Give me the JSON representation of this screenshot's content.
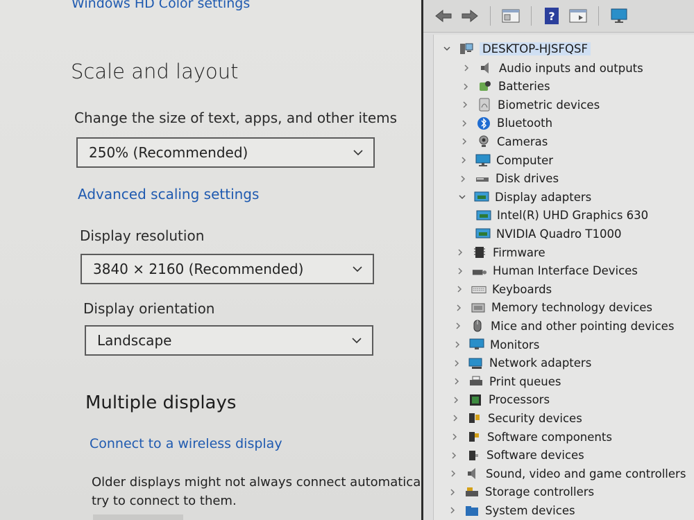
{
  "settings": {
    "top_link": "Windows HD Color settings",
    "scale_section_title": "Scale and layout",
    "scale_label": "Change the size of text, apps, and other items",
    "scale_value": "250% (Recommended)",
    "advanced_link": "Advanced scaling settings",
    "resolution_label": "Display resolution",
    "resolution_value": "3840 × 2160 (Recommended)",
    "orientation_label": "Display orientation",
    "orientation_value": "Landscape",
    "multiple_title": "Multiple displays",
    "wireless_link": "Connect to a wireless display",
    "desc_line1": "Older displays might not always connect automatically",
    "desc_line2": "try to connect to them."
  },
  "devmgr": {
    "toolbar_icons": [
      "back-arrow-icon",
      "forward-arrow-icon",
      "properties-icon",
      "help-icon",
      "update-driver-icon",
      "monitor-icon"
    ],
    "root": "DESKTOP-HJSFQSF",
    "items": [
      {
        "label": "Audio inputs and outputs",
        "icon": "speaker-icon"
      },
      {
        "label": "Batteries",
        "icon": "battery-icon"
      },
      {
        "label": "Biometric devices",
        "icon": "fingerprint-icon"
      },
      {
        "label": "Bluetooth",
        "icon": "bluetooth-icon"
      },
      {
        "label": "Cameras",
        "icon": "camera-icon"
      },
      {
        "label": "Computer",
        "icon": "computer-icon"
      },
      {
        "label": "Disk drives",
        "icon": "disk-icon"
      },
      {
        "label": "Display adapters",
        "icon": "display-adapter-icon"
      },
      {
        "label": "Intel(R) UHD Graphics 630",
        "icon": "display-adapter-icon"
      },
      {
        "label": "NVIDIA Quadro T1000",
        "icon": "display-adapter-icon"
      },
      {
        "label": "Firmware",
        "icon": "chip-icon"
      },
      {
        "label": "Human Interface Devices",
        "icon": "hid-icon"
      },
      {
        "label": "Keyboards",
        "icon": "keyboard-icon"
      },
      {
        "label": "Memory technology devices",
        "icon": "memory-icon"
      },
      {
        "label": "Mice and other pointing devices",
        "icon": "mouse-icon"
      },
      {
        "label": "Monitors",
        "icon": "monitor-icon"
      },
      {
        "label": "Network adapters",
        "icon": "network-icon"
      },
      {
        "label": "Print queues",
        "icon": "printer-icon"
      },
      {
        "label": "Processors",
        "icon": "processor-icon"
      },
      {
        "label": "Security devices",
        "icon": "security-icon"
      },
      {
        "label": "Software components",
        "icon": "software-component-icon"
      },
      {
        "label": "Software devices",
        "icon": "software-device-icon"
      },
      {
        "label": "Sound, video and game controllers",
        "icon": "speaker-icon"
      },
      {
        "label": "Storage controllers",
        "icon": "storage-icon"
      },
      {
        "label": "System devices",
        "icon": "system-folder-icon"
      }
    ]
  },
  "colors": {
    "link": "#1f5ab0",
    "selection": "#cfdff3"
  }
}
